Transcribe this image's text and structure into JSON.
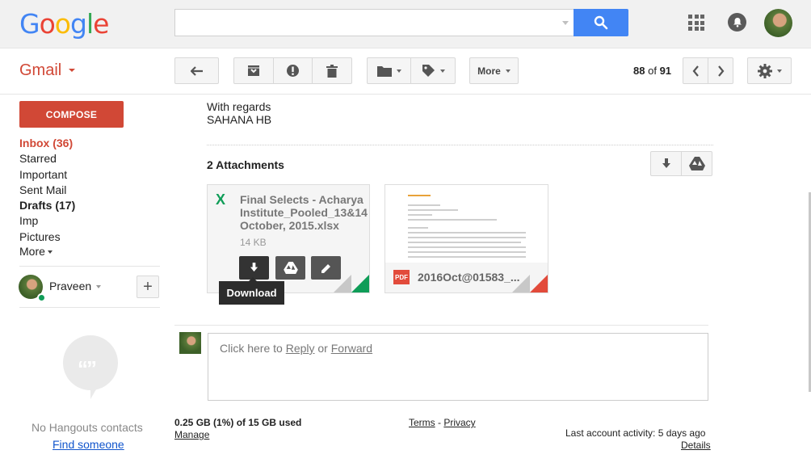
{
  "header": {
    "logo_letters": [
      {
        "ch": "G",
        "color": "#4285f4"
      },
      {
        "ch": "o",
        "color": "#ea4335"
      },
      {
        "ch": "o",
        "color": "#fbbc05"
      },
      {
        "ch": "g",
        "color": "#4285f4"
      },
      {
        "ch": "l",
        "color": "#34a853"
      },
      {
        "ch": "e",
        "color": "#ea4335"
      }
    ],
    "search_value": "",
    "search_icon": "search-icon",
    "apps_icon": "apps-grid-icon",
    "notifications_icon": "bell-icon"
  },
  "toolbar": {
    "app_label": "Gmail",
    "more_label": "More",
    "count_current": "88",
    "count_of": "of",
    "count_total": "91"
  },
  "sidebar": {
    "compose_label": "COMPOSE",
    "items": [
      {
        "label": "Inbox (36)"
      },
      {
        "label": "Starred"
      },
      {
        "label": "Important"
      },
      {
        "label": "Sent Mail"
      },
      {
        "label": "Drafts (17)"
      },
      {
        "label": "Imp"
      },
      {
        "label": "Pictures"
      },
      {
        "label": "More"
      }
    ],
    "user_name": "Praveen",
    "no_contacts": "No Hangouts contacts",
    "find_someone": "Find someone"
  },
  "message": {
    "closing": "With regards",
    "signature": "SAHANA HB",
    "attachments_title": "2 Attachments",
    "attachments": [
      {
        "name_line1": "Final Selects - Acharya",
        "name_line2": "Institute_Pooled_13&14",
        "name_line3": "October, 2015.xlsx",
        "size": "14 KB",
        "type_glyph": "X",
        "accent": "#0f9d58"
      },
      {
        "name": "2016Oct@01583_...",
        "type_label": "PDF",
        "accent": "#e24b3b"
      }
    ],
    "tooltip": "Download"
  },
  "reply": {
    "prefix": "Click here to ",
    "reply_link": "Reply",
    "or": " or ",
    "forward_link": "Forward"
  },
  "footer": {
    "storage": "0.25 GB (1%) of 15 GB used",
    "manage": "Manage",
    "terms": "Terms",
    "sep": " - ",
    "privacy": "Privacy",
    "activity": "Last account activity: 5 days ago",
    "details": "Details"
  },
  "colors": {
    "brand_red": "#d14836",
    "search_blue": "#4285f4"
  }
}
